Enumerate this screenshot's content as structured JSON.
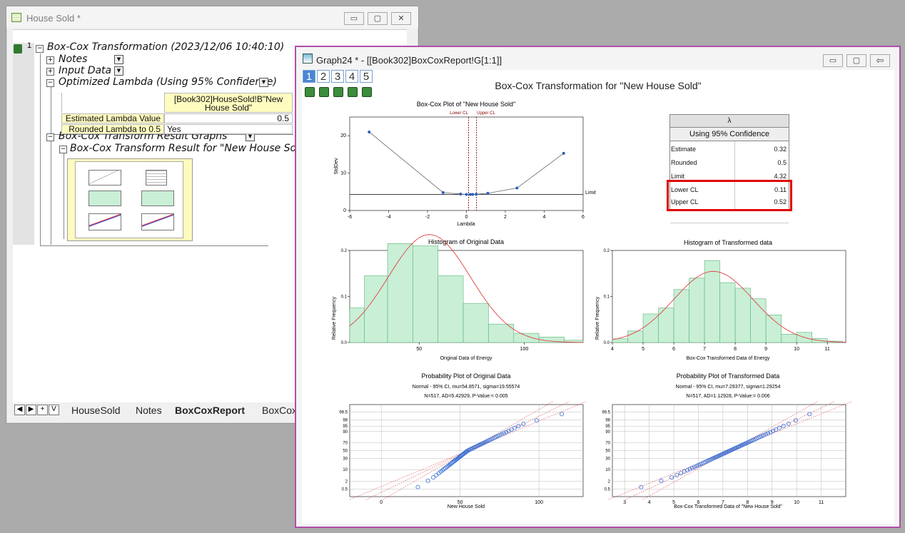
{
  "win1": {
    "title": "House Sold *",
    "controls": {
      "min": "▭",
      "max": "▢",
      "close": "✕"
    },
    "tree": {
      "row_number": "1",
      "root": "Box-Cox Transformation (2023/12/06 10:40:10)",
      "notes": "Notes",
      "input_data": "Input Data",
      "optimized": "Optimized Lambda (Using 95% Confidence)",
      "table_header": "[Book302]HouseSold!B\"New House Sold\"",
      "rows": [
        {
          "label": "Estimated Lambda Value",
          "value": "0.5"
        },
        {
          "label": "Rounded Lambda to 0.5",
          "value": "Yes"
        }
      ],
      "result_graphs": "Box-Cox Transform Result Graphs",
      "result_for": "Box-Cox Transform Result for \"New House Sold\""
    },
    "tabs": [
      "HouseSold",
      "Notes",
      "BoxCoxReport",
      "BoxCox"
    ],
    "tab_nav": [
      "◀",
      "▶",
      "+",
      "V"
    ]
  },
  "win2": {
    "title": "Graph24 * - [[Book302]BoxCoxReport!G[1:1]]",
    "layers": [
      "1",
      "2",
      "3",
      "4",
      "5"
    ],
    "main_title": "Box-Cox Transformation for \"New House Sold\"",
    "boxcox_plot": {
      "title": "Box-Cox Plot of \"New House Sold\"",
      "lower_cl": "Lower CL",
      "upper_cl": "Upper CL",
      "ylabel": "StdDev",
      "xlabel": "Lambda",
      "limit_label": "Limit",
      "xticks": [
        "-6",
        "-4",
        "-2",
        "0",
        "2",
        "4",
        "6"
      ],
      "yticks": [
        "0",
        "10",
        "20"
      ]
    },
    "lambda_table": {
      "header1": "λ",
      "header2": "Using 95% Confidence",
      "rows": [
        {
          "label": "Estimate",
          "value": "0.32"
        },
        {
          "label": "Rounded",
          "value": "0.5"
        },
        {
          "label": "Limit",
          "value": "4.32"
        },
        {
          "label": "Lower CL",
          "value": "0.11"
        },
        {
          "label": "Upper CL",
          "value": "0.52"
        }
      ],
      "highlight_color": "#e00000"
    },
    "hist_orig": {
      "title": "Histogram of Original Data",
      "xlabel": "Original Data of Energy",
      "ylabel": "Relative Frequency",
      "xticks": [
        "50",
        "100"
      ],
      "yticks": [
        "0.0",
        "0.1",
        "0.2"
      ]
    },
    "hist_trans": {
      "title": "Histogram of Transformed data",
      "xlabel": "Box-Cox Transformed Data of Energy",
      "ylabel": "Relative Frequency",
      "xticks": [
        "4",
        "5",
        "6",
        "7",
        "8",
        "9",
        "10",
        "11"
      ],
      "yticks": [
        "0.0",
        "0.1",
        "0.2"
      ]
    },
    "prob_orig": {
      "title": "Probability Plot of Original Data",
      "sub1": "Normal - 95% CI, mu=54.8571, sigma=19.55574",
      "sub2": "N=517, AD=5.42929, P-Value:< 0.005",
      "xlabel": "New House Sold",
      "xticks": [
        "0",
        "50",
        "100"
      ],
      "yticks": [
        "99.5",
        "98",
        "95",
        "90",
        "70",
        "50",
        "30",
        "10",
        "2",
        "0.5"
      ]
    },
    "prob_trans": {
      "title": "Probability Plot of Transformed Data",
      "sub1": "Normal - 95% CI, mu=7.29377, sigma=1.29254",
      "sub2": "N=517, AD=1.12928, P-Value:= 0.006",
      "xlabel": "Box-Cox Transformed Data of \"New House Sold\"",
      "xticks": [
        "3",
        "4",
        "5",
        "6",
        "7",
        "8",
        "9",
        "10",
        "11"
      ],
      "yticks": [
        "99.5",
        "98",
        "95",
        "90",
        "70",
        "50",
        "30",
        "10",
        "2",
        "0.5"
      ]
    }
  },
  "chart_data": [
    {
      "type": "line",
      "title": "Box-Cox Plot of \"New House Sold\"",
      "xlabel": "Lambda",
      "ylabel": "StdDev",
      "xlim": [
        -6,
        6
      ],
      "ylim": [
        0,
        25
      ],
      "x": [
        -5,
        -1.2,
        -0.3,
        0,
        0.2,
        0.32,
        0.5,
        1.1,
        2.6,
        5
      ],
      "y": [
        21,
        4.8,
        4.4,
        4.3,
        4.3,
        4.3,
        4.35,
        4.6,
        6.0,
        15.3
      ],
      "limit": 4.32,
      "lower_cl": 0.11,
      "upper_cl": 0.52
    },
    {
      "type": "bar",
      "title": "Histogram of Original Data",
      "xlabel": "Original Data of Energy",
      "ylabel": "Relative Frequency",
      "xlim": [
        17,
        128
      ],
      "ylim": [
        0,
        0.2
      ],
      "bin_edges": [
        17,
        24,
        35,
        47,
        59,
        71,
        83,
        95,
        107,
        119,
        128
      ],
      "values": [
        0.075,
        0.145,
        0.215,
        0.21,
        0.145,
        0.085,
        0.04,
        0.02,
        0.012,
        0.005
      ]
    },
    {
      "type": "bar",
      "title": "Histogram of Transformed data",
      "xlabel": "Box-Cox Transformed Data of Energy",
      "ylabel": "Relative Frequency",
      "xlim": [
        4,
        11.6
      ],
      "ylim": [
        0,
        0.2
      ],
      "bin_edges": [
        4.0,
        4.5,
        5.0,
        5.5,
        6.0,
        6.5,
        7.0,
        7.5,
        8.0,
        8.5,
        9.0,
        9.5,
        10.0,
        10.5,
        11.0,
        11.5
      ],
      "values": [
        0.008,
        0.025,
        0.062,
        0.075,
        0.115,
        0.14,
        0.178,
        0.13,
        0.118,
        0.095,
        0.06,
        0.018,
        0.022,
        0.009,
        0.003
      ]
    },
    {
      "type": "scatter",
      "title": "Probability Plot of Original Data",
      "xlabel": "New House Sold",
      "xlim": [
        -20,
        128
      ],
      "mu": 54.8571,
      "sigma": 19.55574,
      "n": 517
    },
    {
      "type": "scatter",
      "title": "Probability Plot of Transformed Data",
      "xlabel": "Box-Cox Transformed Data of \"New House Sold\"",
      "xlim": [
        2.5,
        12
      ],
      "mu": 7.29377,
      "sigma": 1.29254,
      "n": 517
    }
  ]
}
